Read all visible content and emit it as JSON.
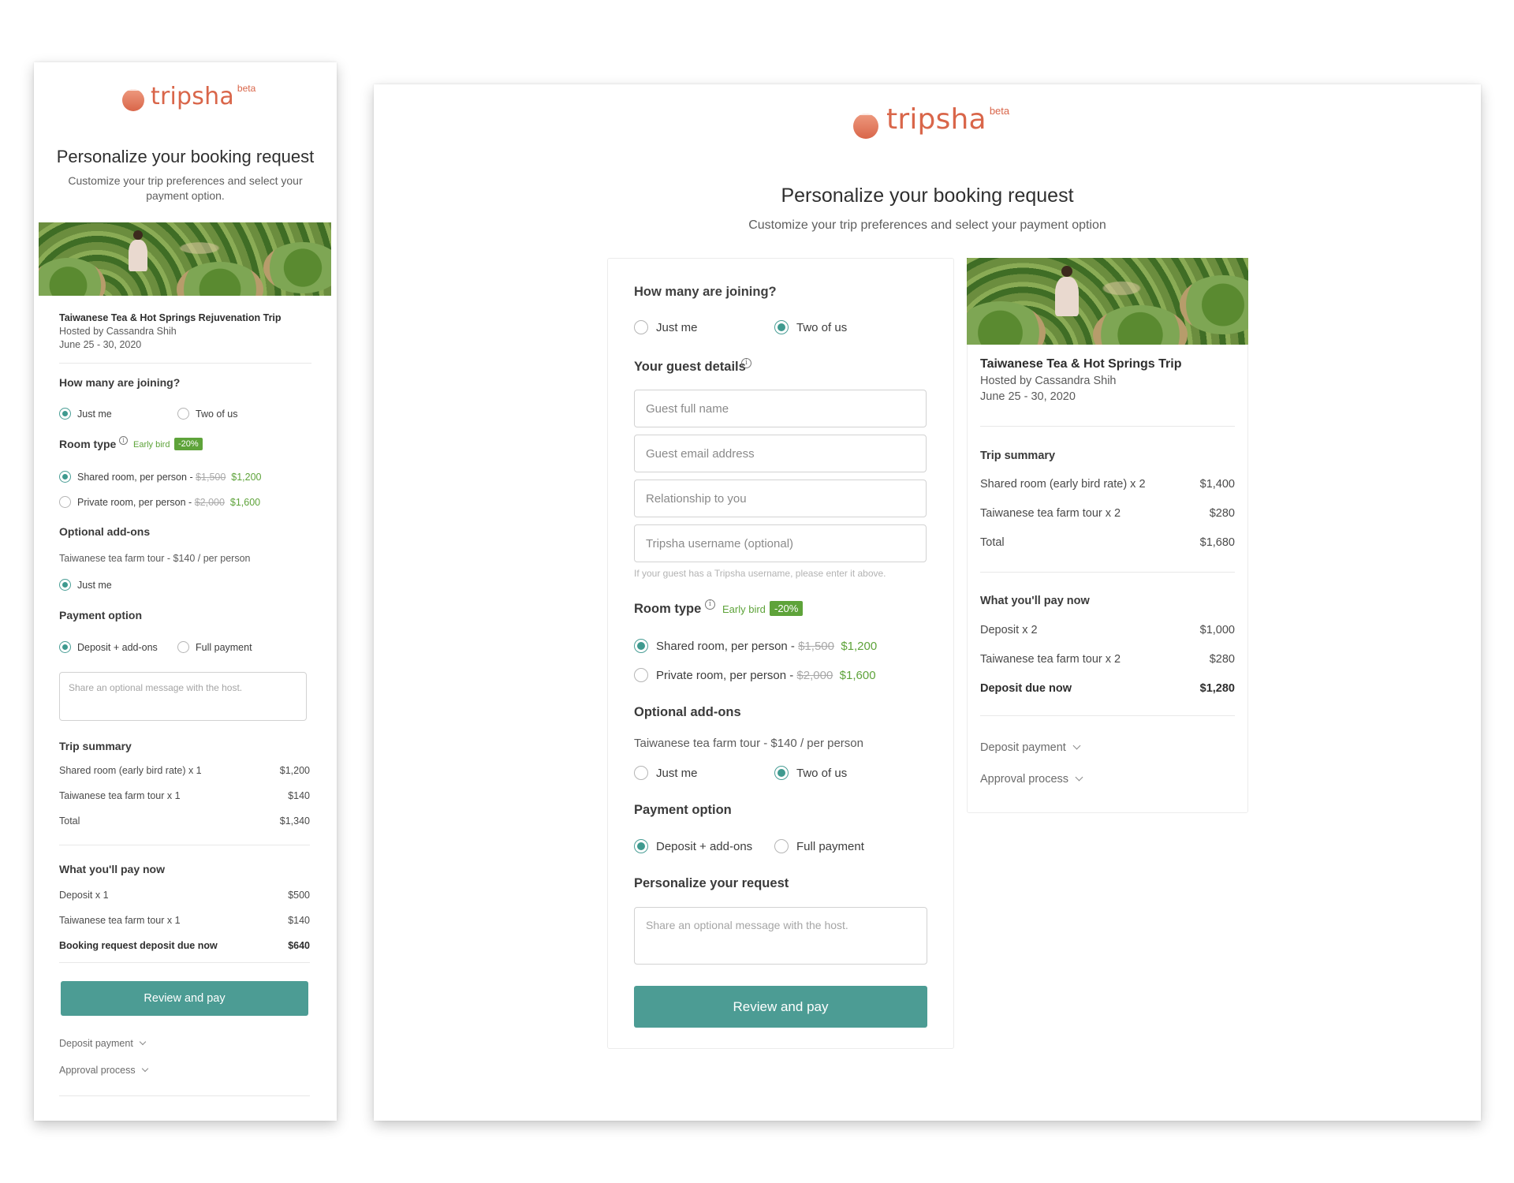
{
  "brand": {
    "name": "tripsha",
    "tag": "beta",
    "accent": "#d9664a",
    "button_color": "#4c9c94",
    "green": "#5ea33a"
  },
  "page": {
    "title": "Personalize your booking request",
    "subtitle_mobile": "Customize your trip preferences and select your payment option.",
    "subtitle_desktop": "Customize your trip preferences and select your payment option"
  },
  "trip": {
    "name": "Taiwanese Tea & Hot Springs Rejuvenation Trip",
    "name_short": "Taiwanese Tea & Hot Springs Trip",
    "host": "Hosted by Cassandra Shih",
    "dates": "June 25 - 30, 2020",
    "photo_icon": "tea-farm-photo"
  },
  "joining": {
    "label": "How many are joining?",
    "options": [
      "Just me",
      "Two of us"
    ]
  },
  "guest": {
    "label": "Your guest details",
    "name_ph": "Guest full name",
    "email_ph": "Guest email address",
    "rel_ph": "Relationship to you",
    "user_ph": "Tripsha username (optional)",
    "hint": "If your guest has a Tripsha username, please enter it above."
  },
  "room": {
    "label": "Room type",
    "early": "Early bird",
    "discount": "-20%",
    "shared_label": "Shared room, per person - ",
    "shared_old": "$1,500",
    "shared_new": "$1,200",
    "private_label": "Private room, per person - ",
    "private_old": "$2,000",
    "private_new": "$1,600"
  },
  "addons": {
    "label": "Optional add-ons",
    "tour": "Taiwanese tea farm tour - $140 / per person",
    "options": [
      "Just me",
      "Two of us"
    ]
  },
  "payment": {
    "label": "Payment option",
    "deposit": "Deposit + add-ons",
    "full": "Full payment"
  },
  "personalize": {
    "label": "Personalize your request",
    "placeholder": "Share an optional message with the host."
  },
  "mobile_summary": {
    "label": "Trip summary",
    "rows": [
      {
        "item": "Shared room (early bird rate) x 1",
        "amount": "$1,200"
      },
      {
        "item": "Taiwanese tea farm tour x 1",
        "amount": "$140"
      },
      {
        "item": "Total",
        "amount": "$1,340"
      }
    ],
    "pay_label": "What you'll pay now",
    "pay_rows": [
      {
        "item": "Deposit x 1",
        "amount": "$500"
      },
      {
        "item": "Taiwanese tea farm tour x 1",
        "amount": "$140"
      }
    ],
    "due": {
      "item": "Booking request deposit due now",
      "amount": "$640"
    }
  },
  "desktop_summary": {
    "label": "Trip summary",
    "rows": [
      {
        "item": "Shared room (early bird rate) x 2",
        "amount": "$1,400"
      },
      {
        "item": "Taiwanese tea farm tour x 2",
        "amount": "$280"
      },
      {
        "item": "Total",
        "amount": "$1,680"
      }
    ],
    "pay_label": "What you'll pay now",
    "pay_rows": [
      {
        "item": "Deposit x 2",
        "amount": "$1,000"
      },
      {
        "item": "Taiwanese tea farm tour x 2",
        "amount": "$280"
      }
    ],
    "due": {
      "item": "Deposit due now",
      "amount": "$1,280"
    }
  },
  "cta": "Review and pay",
  "disclosures": {
    "deposit": "Deposit payment",
    "approval": "Approval process"
  },
  "state": {
    "mobile": {
      "joining": "Just me",
      "room": "shared",
      "addon": "Just me",
      "payment": "deposit"
    },
    "desktop": {
      "joining": "Two of us",
      "room": "shared",
      "addon": "Two of us",
      "payment": "deposit"
    }
  }
}
